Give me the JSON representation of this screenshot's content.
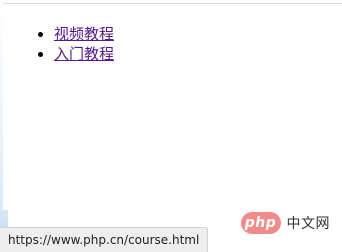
{
  "links": [
    {
      "label": "视频教程"
    },
    {
      "label": "入门教程"
    }
  ],
  "status_bar": {
    "url": "https://www.php.cn/course.html"
  },
  "watermark": {
    "logo_text": "php",
    "site_name": "中文网"
  },
  "colors": {
    "visited_link": "#551a8b",
    "logo_bg": "#f38a8a",
    "status_bar_bg": "#eeeeee"
  }
}
